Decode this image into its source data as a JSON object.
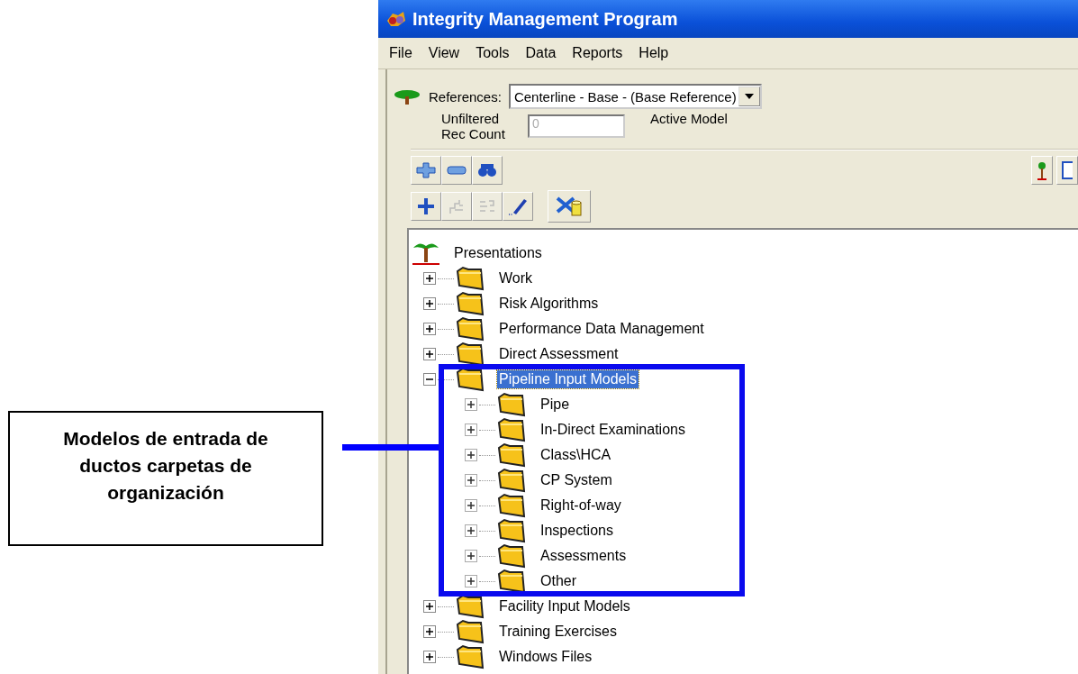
{
  "callout": {
    "text": "Modelos de entrada de ductos carpetas de organización"
  },
  "window": {
    "title": "Integrity Management Program"
  },
  "menu": [
    "File",
    "View",
    "Tools",
    "Data",
    "Reports",
    "Help"
  ],
  "references": {
    "label": "References:",
    "value": "Centerline - Base - (Base Reference)"
  },
  "rec_count": {
    "label": "Unfiltered Rec Count",
    "value": "0",
    "active_model_label": "Active Model"
  },
  "toolbar_2": [
    {
      "disabled": false
    },
    {
      "disabled": true
    },
    {
      "disabled": true
    },
    {
      "disabled": false
    }
  ],
  "tree": {
    "root": "Presentations",
    "items": [
      {
        "label": "Work",
        "expanded": false,
        "selected": false
      },
      {
        "label": "Risk Algorithms",
        "expanded": false,
        "selected": false
      },
      {
        "label": "Performance Data Management",
        "expanded": false,
        "selected": false
      },
      {
        "label": "Direct Assessment",
        "expanded": false,
        "selected": false
      },
      {
        "label": "Pipeline Input Models",
        "expanded": true,
        "selected": true,
        "children": [
          {
            "label": "Pipe",
            "expanded": false,
            "selected": false
          },
          {
            "label": "In-Direct Examinations",
            "expanded": false,
            "selected": false
          },
          {
            "label": "Class\\HCA",
            "expanded": false,
            "selected": false
          },
          {
            "label": "CP System",
            "expanded": false,
            "selected": false
          },
          {
            "label": "Right-of-way",
            "expanded": false,
            "selected": false
          },
          {
            "label": "Inspections",
            "expanded": false,
            "selected": false
          },
          {
            "label": "Assessments",
            "expanded": false,
            "selected": false
          },
          {
            "label": "Other",
            "expanded": false,
            "selected": false
          }
        ]
      },
      {
        "label": "Facility Input Models",
        "expanded": false,
        "selected": false
      },
      {
        "label": "Training Exercises",
        "expanded": false,
        "selected": false
      },
      {
        "label": "Windows Files",
        "expanded": false,
        "selected": false
      }
    ]
  }
}
